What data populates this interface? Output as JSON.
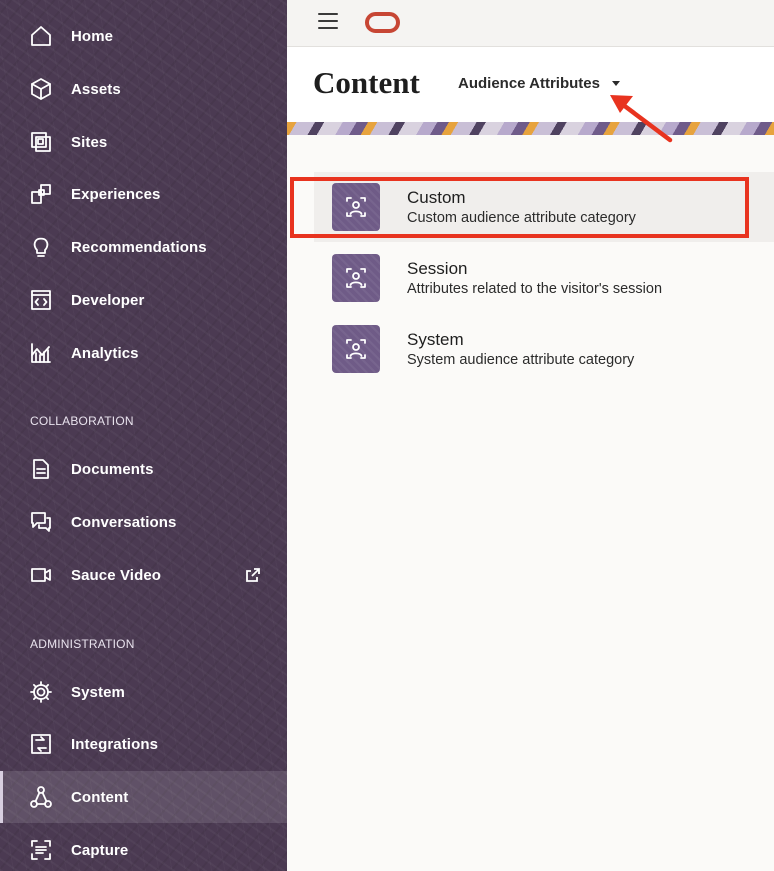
{
  "sidebar": {
    "nav": [
      {
        "label": "Home",
        "icon": "home-icon"
      },
      {
        "label": "Assets",
        "icon": "cube-icon"
      },
      {
        "label": "Sites",
        "icon": "sites-icon"
      },
      {
        "label": "Experiences",
        "icon": "experiences-icon"
      },
      {
        "label": "Recommendations",
        "icon": "lightbulb-icon"
      },
      {
        "label": "Developer",
        "icon": "code-icon"
      },
      {
        "label": "Analytics",
        "icon": "chart-icon"
      }
    ],
    "collaboration_label": "COLLABORATION",
    "collaboration": [
      {
        "label": "Documents",
        "icon": "document-icon"
      },
      {
        "label": "Conversations",
        "icon": "chat-icon"
      },
      {
        "label": "Sauce Video",
        "icon": "video-icon",
        "external": true
      }
    ],
    "administration_label": "ADMINISTRATION",
    "administration": [
      {
        "label": "System",
        "icon": "gear-icon"
      },
      {
        "label": "Integrations",
        "icon": "integrations-icon"
      },
      {
        "label": "Content",
        "icon": "content-hierarchy-icon",
        "active": true
      },
      {
        "label": "Capture",
        "icon": "capture-icon"
      }
    ]
  },
  "header": {
    "title": "Content",
    "dropdown_label": "Audience Attributes"
  },
  "items": [
    {
      "title": "Custom",
      "description": "Custom audience attribute category",
      "selected": true
    },
    {
      "title": "Session",
      "description": "Attributes related to the visitor's session"
    },
    {
      "title": "System",
      "description": "System audience attribute category"
    }
  ],
  "colors": {
    "sidebar": "#4b3a52",
    "tile": "#6f5b87",
    "annotation": "#e8331f",
    "oracle_red": "#c74634"
  }
}
